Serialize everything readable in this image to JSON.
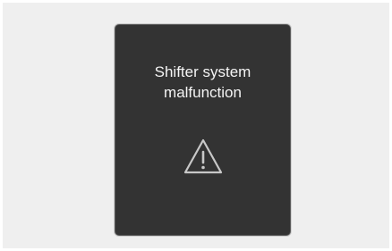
{
  "notification": {
    "message_line1": "Shifter system",
    "message_line2": "malfunction",
    "icon": "warning-triangle-icon"
  },
  "colors": {
    "panel_background": "#333333",
    "text": "#f4f4f4",
    "icon_stroke": "#c8c8c8",
    "page_background": "#efefef"
  }
}
